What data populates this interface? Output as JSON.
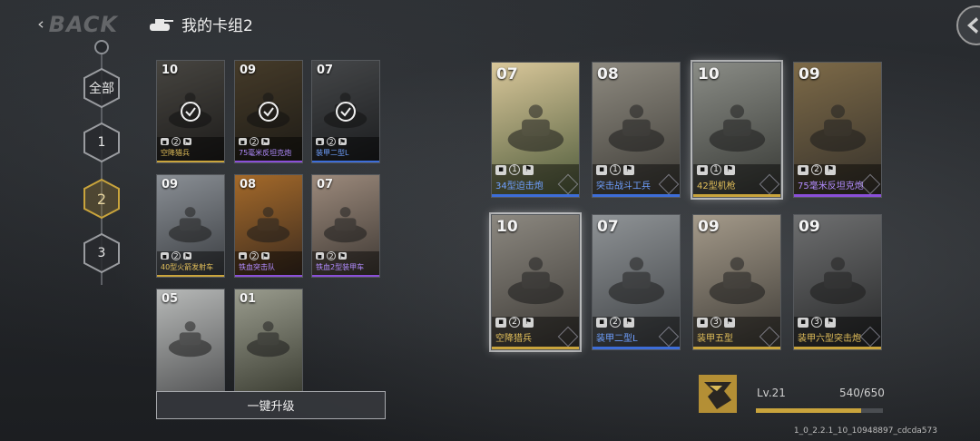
{
  "header": {
    "back_label": "BACK",
    "deck_title": "我的卡组2"
  },
  "rail": {
    "tabs": [
      "全部",
      "1",
      "2",
      "3"
    ],
    "active_index": 2
  },
  "collection": {
    "cards": [
      {
        "level": "10",
        "cost": "2",
        "name": "空降猎兵",
        "rarity": "gold",
        "in_deck": true,
        "art": [
          "#6d6a63",
          "#2d2b29"
        ]
      },
      {
        "level": "09",
        "cost": "2",
        "name": "75毫米反坦克炮",
        "rarity": "purple",
        "in_deck": true,
        "art": [
          "#6b5b40",
          "#2e2a22"
        ]
      },
      {
        "level": "07",
        "cost": "2",
        "name": "装甲二型L",
        "rarity": "blue",
        "in_deck": true,
        "art": [
          "#6a6d70",
          "#2b2d30"
        ]
      },
      {
        "level": "09",
        "cost": "2",
        "name": "40型火箭发射车",
        "rarity": "gold",
        "in_deck": false,
        "art": [
          "#8a8f95",
          "#3a3d41"
        ]
      },
      {
        "level": "08",
        "cost": "2",
        "name": "铁血突击队",
        "rarity": "purple",
        "in_deck": false,
        "art": [
          "#a56a2a",
          "#3a2a1e"
        ]
      },
      {
        "level": "07",
        "cost": "2",
        "name": "铁血2型装甲车",
        "rarity": "purple",
        "in_deck": false,
        "art": [
          "#9c8a7c",
          "#3e3833"
        ]
      },
      {
        "level": "05",
        "cost": "",
        "name": "",
        "rarity": "gold",
        "in_deck": false,
        "art": [
          "#b7b9b8",
          "#58595a"
        ]
      },
      {
        "level": "01",
        "cost": "",
        "name": "",
        "rarity": "gold",
        "in_deck": false,
        "art": [
          "#9a9c8e",
          "#3e4035"
        ]
      }
    ],
    "upgrade_all_label": "一键升级"
  },
  "deck": {
    "cards": [
      {
        "level": "07",
        "cost": "1",
        "name": "34型迫击炮",
        "rarity": "blue",
        "art": [
          "#d9c79a",
          "#4d5a3a"
        ],
        "selected": false
      },
      {
        "level": "08",
        "cost": "1",
        "name": "突击战斗工兵",
        "rarity": "blue",
        "art": [
          "#8e8a80",
          "#3c3a35"
        ],
        "selected": false
      },
      {
        "level": "10",
        "cost": "1",
        "name": "42型机枪",
        "rarity": "gold",
        "art": [
          "#8a8c86",
          "#363834"
        ],
        "selected": true
      },
      {
        "level": "09",
        "cost": "2",
        "name": "75毫米反坦克炮",
        "rarity": "purple",
        "art": [
          "#7d6a48",
          "#34302a"
        ],
        "selected": false
      },
      {
        "level": "10",
        "cost": "2",
        "name": "空降猎兵",
        "rarity": "gold",
        "art": [
          "#8c8880",
          "#3a3733"
        ],
        "selected": true
      },
      {
        "level": "07",
        "cost": "2",
        "name": "装甲二型L",
        "rarity": "blue",
        "art": [
          "#8f9396",
          "#3c3f42"
        ],
        "selected": false
      },
      {
        "level": "09",
        "cost": "3",
        "name": "装甲五型",
        "rarity": "gold",
        "art": [
          "#a49a8a",
          "#3d3a35"
        ],
        "selected": false
      },
      {
        "level": "09",
        "cost": "3",
        "name": "装甲六型突击炮",
        "rarity": "gold",
        "art": [
          "#6e6f70",
          "#262728"
        ],
        "selected": false
      }
    ]
  },
  "player": {
    "level_label": "Lv.21",
    "xp_text": "540/650",
    "xp_progress": 0.83
  },
  "version": "1_0_2.2.1_10_10948897_cdcda573",
  "colors": {
    "gold": "#c9a43c",
    "blue": "#3d6dd8",
    "purple": "#8a4fd8"
  }
}
